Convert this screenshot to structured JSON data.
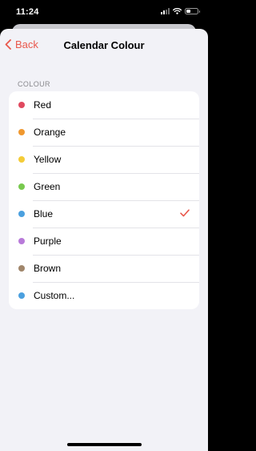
{
  "status": {
    "time": "11:24"
  },
  "nav": {
    "back_label": "Back",
    "title": "Calendar Colour"
  },
  "section": {
    "header": "COLOUR"
  },
  "colors": [
    {
      "label": "Red",
      "hex": "#e0495f",
      "selected": false
    },
    {
      "label": "Orange",
      "hex": "#f0982f",
      "selected": false
    },
    {
      "label": "Yellow",
      "hex": "#f4cc38",
      "selected": false
    },
    {
      "label": "Green",
      "hex": "#78c94e",
      "selected": false
    },
    {
      "label": "Blue",
      "hex": "#4ba0df",
      "selected": true
    },
    {
      "label": "Purple",
      "hex": "#b87ad9",
      "selected": false
    },
    {
      "label": "Brown",
      "hex": "#a0866b",
      "selected": false
    },
    {
      "label": "Custom...",
      "hex": "#4ba0df",
      "selected": false
    }
  ],
  "theme": {
    "accent": "#e9574b",
    "background": "#f2f2f7"
  }
}
